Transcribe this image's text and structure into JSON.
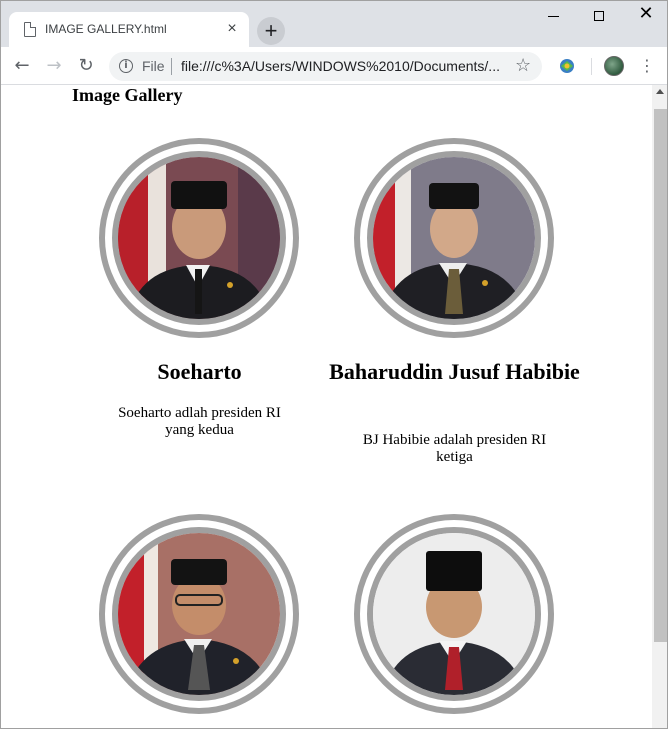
{
  "browser": {
    "tab_title": "IMAGE GALLERY.html",
    "tab_close": "×",
    "new_tab": "+",
    "scheme_label": "File",
    "url": "file:///c%3A/Users/WINDOWS%2010/Documents/...",
    "accent": "#dee1e6"
  },
  "page": {
    "heading": "Image Gallery"
  },
  "gallery": [
    {
      "name": "Soeharto",
      "desc": "Soeharto adlah presiden RI yang kedua",
      "tie": "#1a1a1a",
      "bg": "#7a3b3b"
    },
    {
      "name": "Baharuddin Jusuf Habibie",
      "desc": "BJ Habibie adalah presiden RI ketiga",
      "tie": "#6b5d3a",
      "bg": "#8a8a9a"
    },
    {
      "name": "",
      "desc": "",
      "tie": "#444444",
      "bg": "#a46a5c"
    },
    {
      "name": "",
      "desc": "",
      "tie": "#b0202a",
      "bg": "#e8e8e8"
    }
  ]
}
